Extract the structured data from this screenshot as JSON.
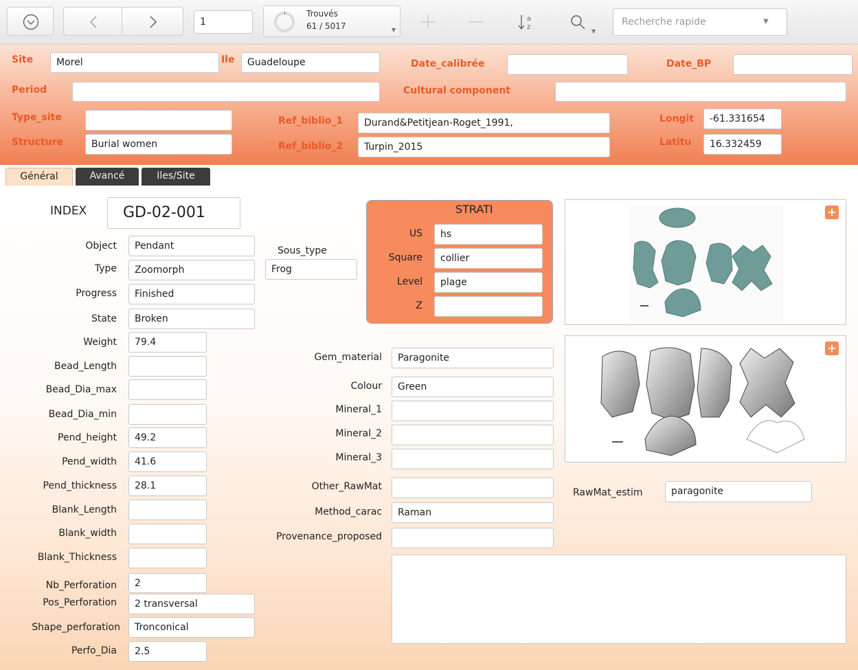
{
  "toolbar": {
    "record_number": "1",
    "found_label": "Trouvés",
    "found_count": "61 / 5017",
    "search_placeholder": "Recherche rapide"
  },
  "header": {
    "site_label": "Site",
    "site_value": "Morel",
    "ile_label": "Ile",
    "ile_value": "Guadeloupe",
    "date_calibree_label": "Date_calibrée",
    "date_calibree_value": "",
    "date_bp_label": "Date_BP",
    "date_bp_value": "",
    "period_label": "Period",
    "period_value": "",
    "cultural_component_label": "Cultural component",
    "cultural_component_value": "",
    "type_site_label": "Type_site",
    "type_site_value": "",
    "ref_biblio_1_label": "Ref_biblio_1",
    "ref_biblio_1_value": "Durand&Petitjean-Roget_1991,",
    "longitude_label": "Longit",
    "longitude_value": "-61.331654",
    "structure_label": "Structure",
    "structure_value": "Burial women",
    "ref_biblio_2_label": "Ref_biblio_2",
    "ref_biblio_2_value": "Turpin_2015",
    "latitude_label": "Latitu",
    "latitude_value": "16.332459"
  },
  "tabs": [
    {
      "label": "Général",
      "active": true
    },
    {
      "label": "Avancé",
      "active": false
    },
    {
      "label": "Iles/Site",
      "active": false
    }
  ],
  "general": {
    "index_label": "INDEX",
    "index_value": "GD-02-001",
    "object_label": "Object",
    "object_value": "Pendant",
    "type_label": "Type",
    "type_value": "Zoomorph",
    "progress_label": "Progress",
    "progress_value": "Finished",
    "state_label": "State",
    "state_value": "Broken",
    "weight_label": "Weight",
    "weight_value": "79.4",
    "bead_length_label": "Bead_Length",
    "bead_length_value": "",
    "bead_dia_max_label": "Bead_Dia_max",
    "bead_dia_max_value": "",
    "bead_dia_min_label": "Bead_Dia_min",
    "bead_dia_min_value": "",
    "pend_height_label": "Pend_height",
    "pend_height_value": "49.2",
    "pend_width_label": "Pend_width",
    "pend_width_value": "41.6",
    "pend_thickness_label": "Pend_thickness",
    "pend_thickness_value": "28.1",
    "blank_length_label": "Blank_Length",
    "blank_length_value": "",
    "blank_width_label": "Blank_width",
    "blank_width_value": "",
    "blank_thickness_label": "Blank_Thickness",
    "blank_thickness_value": "",
    "nb_perforation_label": "Nb_Perforation",
    "nb_perforation_value": "2",
    "pos_perforation_label": "Pos_Perforation",
    "pos_perforation_value": "2 transversal",
    "shape_perforation_label": "Shape_perforation",
    "shape_perforation_value": "Tronconical",
    "perfo_dia_label": "Perfo_Dia",
    "perfo_dia_value": "2.5",
    "sous_type_label": "Sous_type",
    "sous_type_value": "Frog",
    "gem_material_label": "Gem_material",
    "gem_material_value": "Paragonite",
    "colour_label": "Colour",
    "colour_value": "Green",
    "mineral_1_label": "Mineral_1",
    "mineral_1_value": "",
    "mineral_2_label": "Mineral_2",
    "mineral_2_value": "",
    "mineral_3_label": "Mineral_3",
    "mineral_3_value": "",
    "other_rawmat_label": "Other_RawMat",
    "other_rawmat_value": "",
    "method_carac_label": "Method_carac",
    "method_carac_value": "Raman",
    "provenance_label": "Provenance_proposed",
    "provenance_value": "",
    "rawmat_estim_label": "RawMat_estim",
    "rawmat_estim_value": "paragonite",
    "notes_value": ""
  },
  "strati": {
    "title": "STRATI",
    "us_label": "US",
    "us_value": "hs",
    "square_label": "Square",
    "square_value": "collier",
    "level_label": "Level",
    "level_value": "plage",
    "z_label": "Z",
    "z_value": ""
  },
  "icons": {
    "menu": "circle-chevron-down-icon",
    "prev": "chevron-left-icon",
    "next": "chevron-right-icon",
    "found": "progress-ring-icon",
    "add": "plus-icon",
    "remove": "minus-icon",
    "sort": "sort-az-icon",
    "search": "magnifier-icon",
    "dropdown": "triangle-down-icon"
  },
  "colors": {
    "header_label": "#ea5a28",
    "strati_bg": "#f78b5e",
    "plus_button": "#f08e55",
    "active_tab": "#fde0c6",
    "inactive_tab": "#3c3c3c"
  }
}
